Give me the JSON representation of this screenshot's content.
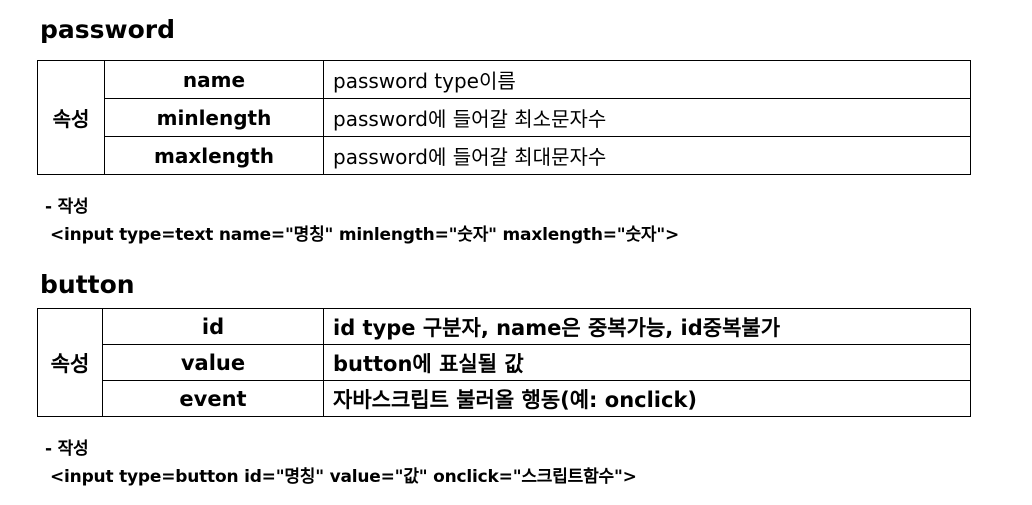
{
  "sections": [
    {
      "title": "password",
      "group_label": "속성",
      "rows": [
        {
          "key": "name",
          "value": "password type이름"
        },
        {
          "key": "minlength",
          "value": "password에 들어갈 최소문자수"
        },
        {
          "key": "maxlength",
          "value": "password에 들어갈 최대문자수"
        }
      ],
      "note_title": "- 작성",
      "note_code": "<input type=text name=\"명칭\"  minlength=\"숫자\" maxlength=\"숫자\">"
    },
    {
      "title": "button",
      "group_label": "속성",
      "rows": [
        {
          "key": "id",
          "value": "id type 구분자, name은 중복가능, id중복불가"
        },
        {
          "key": "value",
          "value": "button에 표실될 값"
        },
        {
          "key": "event",
          "value": "자바스크립트 불러올 행동(예: onclick)"
        }
      ],
      "note_title": "- 작성",
      "note_code": "<input type=button id=\"명칭\" value=\"값\" onclick=\"스크립트함수\">"
    }
  ]
}
